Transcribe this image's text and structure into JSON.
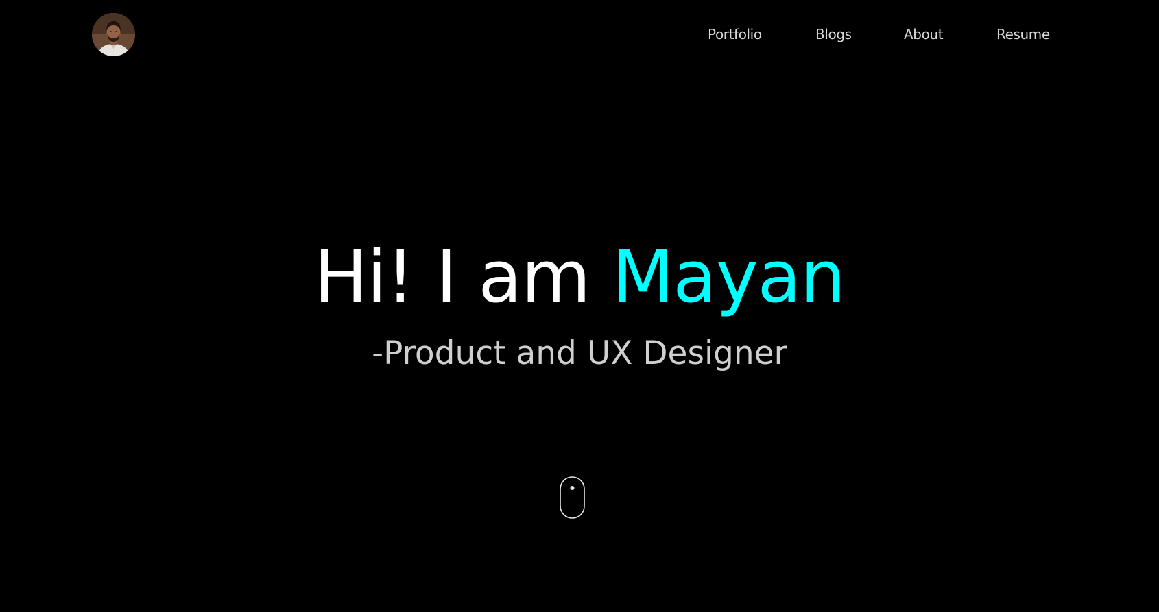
{
  "header": {
    "avatar_alt": "Mayan profile photo",
    "nav": {
      "portfolio": "Portfolio",
      "blogs": "Blogs",
      "about": "About",
      "resume": "Resume"
    }
  },
  "hero": {
    "greeting": "Hi! I am ",
    "name": "Mayan",
    "subtitle": "-Product and UX Designer"
  },
  "scroll_indicator": {
    "icon": "mouse-scroll-icon"
  },
  "colors": {
    "background": "#000000",
    "accent": "#00ffff",
    "heading": "#ffffff",
    "nav_text": "#d9d9d9",
    "subtitle_text": "#cfcfcf"
  }
}
